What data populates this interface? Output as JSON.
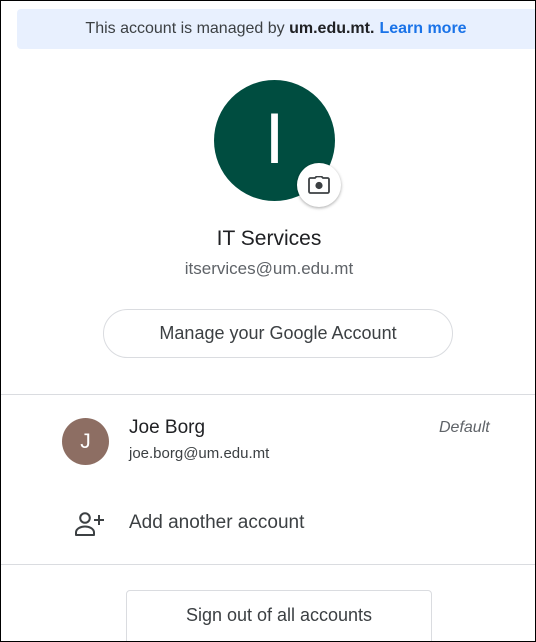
{
  "banner": {
    "prefix": "This account is managed by",
    "domain": "um.edu.mt.",
    "learn_more": "Learn more"
  },
  "profile": {
    "initial": "I",
    "name": "IT Services",
    "email": "itservices@um.edu.mt",
    "avatar_color": "#004d40",
    "camera_icon": "camera-icon"
  },
  "manage_button": "Manage your Google Account",
  "accounts": [
    {
      "initial": "J",
      "name": "Joe Borg",
      "email": "joe.borg@um.edu.mt",
      "badge": "Default",
      "avatar_color": "#8d6e63"
    }
  ],
  "add_account": {
    "icon": "person-add-icon",
    "label": "Add another account"
  },
  "sign_out": "Sign out of all accounts",
  "colors": {
    "banner_bg": "#e8f0fe",
    "link": "#1a73e8",
    "border": "#dadce0"
  }
}
